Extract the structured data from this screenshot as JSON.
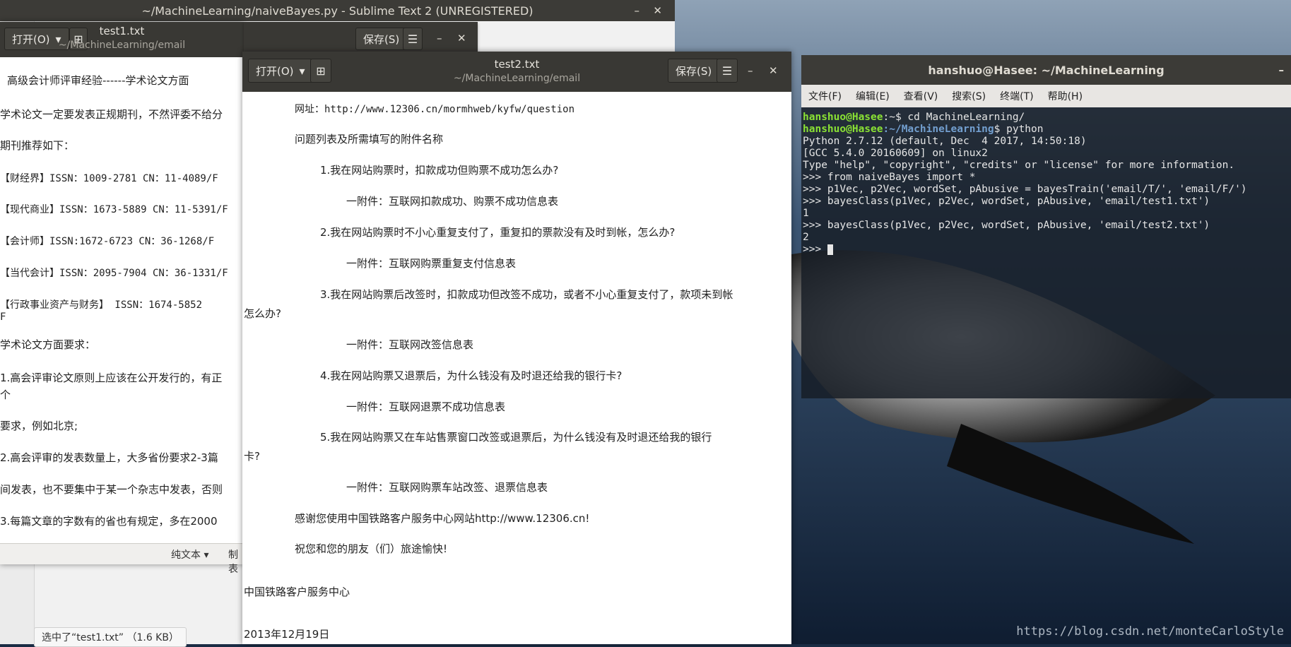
{
  "sublime": {
    "title": "~/MachineLearning/naiveBayes.py - Sublime Text 2 (UNREGISTERED)",
    "minimize": "–",
    "close": "✕",
    "status": "选中了“test1.txt” （1.6 KB）"
  },
  "gedit1": {
    "open_label": "打开(O)",
    "save_label": "保存(S)",
    "title": "test1.txt",
    "path": "~/MachineLearning/email",
    "minimize": "–",
    "close": "✕",
    "lines": [
      "高级会计师评审经验------学术论文方面",
      "学术论文一定要发表正规期刊，不然评委不给分",
      "期刊推荐如下：",
      "【财经界】ISSN：1009-2781  CN：11-4089/F",
      "【现代商业】ISSN：1673-5889    CN：11-5391/F",
      "【会计师】ISSN:1672-6723  CN：36-1268/F",
      "【当代会计】ISSN：2095-7904  CN：36-1331/F",
      "【行政事业资产与财务】    ISSN：1674-5852",
      "F",
      "学术论文方面要求：",
      "1.高会评审论文原则上应该在公开发行的，有正",
      "个",
      "要求，例如北京;",
      "2.高会评审的发表数量上，大多省份要求2-3篇",
      "间发表，也不要集中于某一个杂志中发表，否则",
      "3.每篇文章的字数有的省也有规定，多在2000"
    ],
    "status_format": "纯文本",
    "status_tab": "制表"
  },
  "gedit2": {
    "open_label": "打开(O)",
    "save_label": "保存(S)",
    "title": "test2.txt",
    "path": "~/MachineLearning/email",
    "minimize": "–",
    "close": "✕",
    "lines": [
      "网址：http://www.12306.cn/mormhweb/kyfw/question",
      "问题列表及所需填写的附件名称",
      "1.我在网站购票时，扣款成功但购票不成功怎么办?",
      "一附件：互联网扣款成功、购票不成功信息表",
      "2.我在网站购票时不小心重复支付了，重复扣的票款没有及时到帐，怎么办?",
      "一附件：互联网购票重复支付信息表",
      "3.我在网站购票后改签时，扣款成功但改签不成功，或者不小心重复支付了，款项未到帐",
      "怎么办?",
      "一附件：互联网改签信息表",
      "4.我在网站购票又退票后，为什么钱没有及时退还给我的银行卡?",
      "一附件：互联网退票不成功信息表",
      "5.我在网站购票又在车站售票窗口改签或退票后，为什么钱没有及时退还给我的银行",
      "卡?",
      "一附件：互联网购票车站改签、退票信息表",
      "感谢您使用中国铁路客户服务中心网站http://www.12306.cn!",
      "祝您和您的朋友（们）旅途愉快!",
      "中国铁路客户服务中心",
      "2013年12月19日"
    ]
  },
  "terminal": {
    "title": "hanshuo@Hasee: ~/MachineLearning",
    "minimize": "–",
    "menu": [
      "文件(F)",
      "编辑(E)",
      "查看(V)",
      "搜索(S)",
      "终端(T)",
      "帮助(H)"
    ],
    "prompt_user": "hanshuo@Hasee",
    "prompt_home": ":~$ ",
    "prompt_ml_path": ":~/MachineLearning",
    "prompt_ml_end": "$ ",
    "cmd1": "cd MachineLearning/",
    "cmd2": "python",
    "output": [
      "Python 2.7.12 (default, Dec  4 2017, 14:50:18)",
      "[GCC 5.4.0 20160609] on linux2",
      "Type \"help\", \"copyright\", \"credits\" or \"license\" for more information.",
      ">>> from naiveBayes import *",
      ">>> p1Vec, p2Vec, wordSet, pAbusive = bayesTrain('email/T/', 'email/F/')",
      ">>> bayesClass(p1Vec, p2Vec, wordSet, pAbusive, 'email/test1.txt')",
      "1",
      ">>> bayesClass(p1Vec, p2Vec, wordSet, pAbusive, 'email/test2.txt')",
      "2"
    ],
    "last_prompt": ">>> "
  },
  "watermark": "https://blog.csdn.net/monteCarloStyle"
}
